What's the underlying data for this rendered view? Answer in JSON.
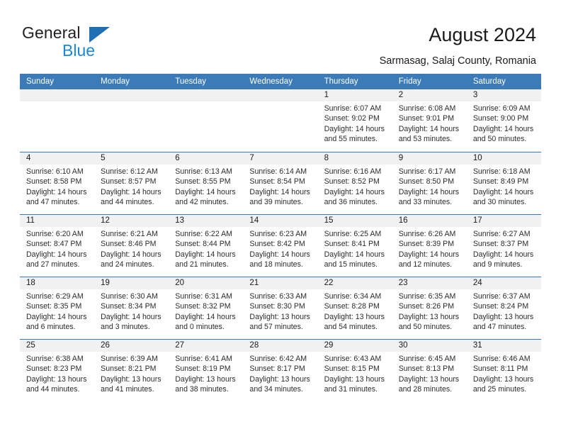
{
  "brand": {
    "name_top": "General",
    "name_bottom": "Blue",
    "triangle_color": "#1f6fb5",
    "blue_text_color": "#1b87d8",
    "logo_icon": "general-blue-logo"
  },
  "header": {
    "title": "August 2024",
    "subtitle": "Sarmasag, Salaj County, Romania"
  },
  "theme": {
    "header_bar_color": "#3b7cb8",
    "daynum_band_color": "#f1f1f1",
    "row_divider_color": "#3b7cb8",
    "text_color": "#1a1a1a"
  },
  "weekdays": [
    "Sunday",
    "Monday",
    "Tuesday",
    "Wednesday",
    "Thursday",
    "Friday",
    "Saturday"
  ],
  "weeks": [
    [
      {
        "day": "",
        "lines": []
      },
      {
        "day": "",
        "lines": []
      },
      {
        "day": "",
        "lines": []
      },
      {
        "day": "",
        "lines": []
      },
      {
        "day": "1",
        "lines": [
          "Sunrise: 6:07 AM",
          "Sunset: 9:02 PM",
          "Daylight: 14 hours",
          "and 55 minutes."
        ]
      },
      {
        "day": "2",
        "lines": [
          "Sunrise: 6:08 AM",
          "Sunset: 9:01 PM",
          "Daylight: 14 hours",
          "and 53 minutes."
        ]
      },
      {
        "day": "3",
        "lines": [
          "Sunrise: 6:09 AM",
          "Sunset: 9:00 PM",
          "Daylight: 14 hours",
          "and 50 minutes."
        ]
      }
    ],
    [
      {
        "day": "4",
        "lines": [
          "Sunrise: 6:10 AM",
          "Sunset: 8:58 PM",
          "Daylight: 14 hours",
          "and 47 minutes."
        ]
      },
      {
        "day": "5",
        "lines": [
          "Sunrise: 6:12 AM",
          "Sunset: 8:57 PM",
          "Daylight: 14 hours",
          "and 44 minutes."
        ]
      },
      {
        "day": "6",
        "lines": [
          "Sunrise: 6:13 AM",
          "Sunset: 8:55 PM",
          "Daylight: 14 hours",
          "and 42 minutes."
        ]
      },
      {
        "day": "7",
        "lines": [
          "Sunrise: 6:14 AM",
          "Sunset: 8:54 PM",
          "Daylight: 14 hours",
          "and 39 minutes."
        ]
      },
      {
        "day": "8",
        "lines": [
          "Sunrise: 6:16 AM",
          "Sunset: 8:52 PM",
          "Daylight: 14 hours",
          "and 36 minutes."
        ]
      },
      {
        "day": "9",
        "lines": [
          "Sunrise: 6:17 AM",
          "Sunset: 8:50 PM",
          "Daylight: 14 hours",
          "and 33 minutes."
        ]
      },
      {
        "day": "10",
        "lines": [
          "Sunrise: 6:18 AM",
          "Sunset: 8:49 PM",
          "Daylight: 14 hours",
          "and 30 minutes."
        ]
      }
    ],
    [
      {
        "day": "11",
        "lines": [
          "Sunrise: 6:20 AM",
          "Sunset: 8:47 PM",
          "Daylight: 14 hours",
          "and 27 minutes."
        ]
      },
      {
        "day": "12",
        "lines": [
          "Sunrise: 6:21 AM",
          "Sunset: 8:46 PM",
          "Daylight: 14 hours",
          "and 24 minutes."
        ]
      },
      {
        "day": "13",
        "lines": [
          "Sunrise: 6:22 AM",
          "Sunset: 8:44 PM",
          "Daylight: 14 hours",
          "and 21 minutes."
        ]
      },
      {
        "day": "14",
        "lines": [
          "Sunrise: 6:23 AM",
          "Sunset: 8:42 PM",
          "Daylight: 14 hours",
          "and 18 minutes."
        ]
      },
      {
        "day": "15",
        "lines": [
          "Sunrise: 6:25 AM",
          "Sunset: 8:41 PM",
          "Daylight: 14 hours",
          "and 15 minutes."
        ]
      },
      {
        "day": "16",
        "lines": [
          "Sunrise: 6:26 AM",
          "Sunset: 8:39 PM",
          "Daylight: 14 hours",
          "and 12 minutes."
        ]
      },
      {
        "day": "17",
        "lines": [
          "Sunrise: 6:27 AM",
          "Sunset: 8:37 PM",
          "Daylight: 14 hours",
          "and 9 minutes."
        ]
      }
    ],
    [
      {
        "day": "18",
        "lines": [
          "Sunrise: 6:29 AM",
          "Sunset: 8:35 PM",
          "Daylight: 14 hours",
          "and 6 minutes."
        ]
      },
      {
        "day": "19",
        "lines": [
          "Sunrise: 6:30 AM",
          "Sunset: 8:34 PM",
          "Daylight: 14 hours",
          "and 3 minutes."
        ]
      },
      {
        "day": "20",
        "lines": [
          "Sunrise: 6:31 AM",
          "Sunset: 8:32 PM",
          "Daylight: 14 hours",
          "and 0 minutes."
        ]
      },
      {
        "day": "21",
        "lines": [
          "Sunrise: 6:33 AM",
          "Sunset: 8:30 PM",
          "Daylight: 13 hours",
          "and 57 minutes."
        ]
      },
      {
        "day": "22",
        "lines": [
          "Sunrise: 6:34 AM",
          "Sunset: 8:28 PM",
          "Daylight: 13 hours",
          "and 54 minutes."
        ]
      },
      {
        "day": "23",
        "lines": [
          "Sunrise: 6:35 AM",
          "Sunset: 8:26 PM",
          "Daylight: 13 hours",
          "and 50 minutes."
        ]
      },
      {
        "day": "24",
        "lines": [
          "Sunrise: 6:37 AM",
          "Sunset: 8:24 PM",
          "Daylight: 13 hours",
          "and 47 minutes."
        ]
      }
    ],
    [
      {
        "day": "25",
        "lines": [
          "Sunrise: 6:38 AM",
          "Sunset: 8:23 PM",
          "Daylight: 13 hours",
          "and 44 minutes."
        ]
      },
      {
        "day": "26",
        "lines": [
          "Sunrise: 6:39 AM",
          "Sunset: 8:21 PM",
          "Daylight: 13 hours",
          "and 41 minutes."
        ]
      },
      {
        "day": "27",
        "lines": [
          "Sunrise: 6:41 AM",
          "Sunset: 8:19 PM",
          "Daylight: 13 hours",
          "and 38 minutes."
        ]
      },
      {
        "day": "28",
        "lines": [
          "Sunrise: 6:42 AM",
          "Sunset: 8:17 PM",
          "Daylight: 13 hours",
          "and 34 minutes."
        ]
      },
      {
        "day": "29",
        "lines": [
          "Sunrise: 6:43 AM",
          "Sunset: 8:15 PM",
          "Daylight: 13 hours",
          "and 31 minutes."
        ]
      },
      {
        "day": "30",
        "lines": [
          "Sunrise: 6:45 AM",
          "Sunset: 8:13 PM",
          "Daylight: 13 hours",
          "and 28 minutes."
        ]
      },
      {
        "day": "31",
        "lines": [
          "Sunrise: 6:46 AM",
          "Sunset: 8:11 PM",
          "Daylight: 13 hours",
          "and 25 minutes."
        ]
      }
    ]
  ]
}
